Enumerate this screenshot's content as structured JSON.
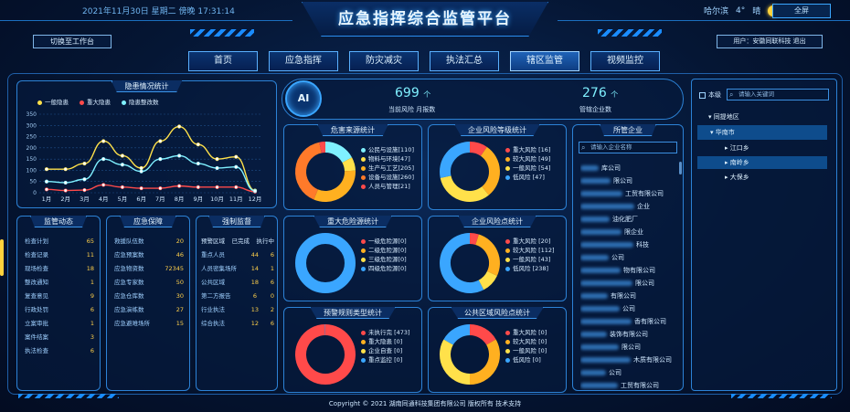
{
  "header": {
    "title": "应急指挥综合监管平台",
    "datetime": "2021年11月30日 星期二 傍晚 17:31:14",
    "location": "哈尔滨",
    "temperature": "4°",
    "weather": "晴",
    "fullscreen_label": "全屏",
    "switch_label": "切换至工作台",
    "user_label": "用户：安徽同联科技  退出"
  },
  "nav": {
    "tabs": [
      {
        "label": "首页"
      },
      {
        "label": "应急指挥"
      },
      {
        "label": "防灾减灾"
      },
      {
        "label": "执法汇总"
      },
      {
        "label": "辖区监管"
      },
      {
        "label": "视频监控"
      }
    ],
    "active_index": 4
  },
  "hazard_chart": {
    "title": "隐患情况统计",
    "legend": [
      "一般隐患",
      "重大隐患",
      "隐患整改数"
    ],
    "colors": [
      "#ffe14a",
      "#ff4a4a",
      "#7ff0ff"
    ]
  },
  "chart_data": {
    "type": "line",
    "categories": [
      "1月",
      "2月",
      "3月",
      "4月",
      "5月",
      "6月",
      "7月",
      "8月",
      "9月",
      "10月",
      "11月",
      "12月"
    ],
    "ylim": [
      0,
      350
    ],
    "yticks": [
      0,
      50,
      100,
      150,
      200,
      250,
      300,
      350
    ],
    "series": [
      {
        "name": "一般隐患",
        "color": "#ffe14a",
        "values": [
          105,
          105,
          130,
          230,
          165,
          110,
          230,
          295,
          215,
          150,
          160,
          10
        ]
      },
      {
        "name": "重大隐患",
        "color": "#ff4a4a",
        "values": [
          15,
          10,
          12,
          35,
          25,
          20,
          20,
          30,
          25,
          25,
          25,
          5
        ]
      },
      {
        "name": "隐患整改数",
        "color": "#7ff0ff",
        "values": [
          50,
          45,
          60,
          150,
          125,
          95,
          150,
          165,
          130,
          110,
          115,
          8
        ]
      }
    ]
  },
  "stats": {
    "current_risk_value": "699",
    "current_risk_unit": "个",
    "current_risk_label": "当前风险 月报数",
    "enterprise_value": "276",
    "enterprise_unit": "个",
    "enterprise_label": "管辖企业数"
  },
  "donuts": [
    {
      "title": "危害来源统计",
      "colors": [
        "#7ff0ff",
        "#ffe14a",
        "#ffb020",
        "#ff7a2a",
        "#ff4a4a"
      ],
      "legend": [
        {
          "label": "公民与设施[110]"
        },
        {
          "label": "物料与环境[47]"
        },
        {
          "label": "生产与工艺[205]"
        },
        {
          "label": "设备与设施[260]"
        },
        {
          "label": "人员与管理[21]"
        }
      ],
      "values": [
        110,
        47,
        205,
        260,
        21
      ]
    },
    {
      "title": "企业风险等级统计",
      "colors": [
        "#ff4a4a",
        "#ffb020",
        "#ffe14a",
        "#3aa6ff"
      ],
      "legend": [
        {
          "label": "重大风险 [16]"
        },
        {
          "label": "较大风险 [49]"
        },
        {
          "label": "一般风险 [54]"
        },
        {
          "label": "低风险 [47]"
        }
      ],
      "values": [
        16,
        49,
        54,
        47
      ]
    },
    {
      "title": "重大危险源统计",
      "colors": [
        "#ff4a4a",
        "#ffb020",
        "#ffe14a",
        "#3aa6ff"
      ],
      "legend": [
        {
          "label": "一级危险源[0]"
        },
        {
          "label": "二级危险源[0]"
        },
        {
          "label": "三级危险源[0]"
        },
        {
          "label": "四级危险源[0]"
        }
      ],
      "values": [
        0,
        0,
        0,
        1
      ]
    },
    {
      "title": "企业风险点统计",
      "colors": [
        "#ff4a4a",
        "#ffb020",
        "#ffe14a",
        "#3aa6ff"
      ],
      "legend": [
        {
          "label": "重大风险 [20]"
        },
        {
          "label": "较大风险 [112]"
        },
        {
          "label": "一般风险 [43]"
        },
        {
          "label": "低风险 [238]"
        }
      ],
      "values": [
        20,
        112,
        43,
        238
      ]
    },
    {
      "title": "预警规则类型统计",
      "colors": [
        "#ff4a4a",
        "#ffb020",
        "#ffe14a",
        "#3aa6ff"
      ],
      "legend": [
        {
          "label": "未执行完 [473]"
        },
        {
          "label": "重大隐患 [0]"
        },
        {
          "label": "企业自查 [0]"
        },
        {
          "label": "重点监控 [0]"
        }
      ],
      "values": [
        473,
        0,
        0,
        1
      ]
    },
    {
      "title": "公共区域风险点统计",
      "colors": [
        "#ff4a4a",
        "#ffb020",
        "#ffe14a",
        "#3aa6ff"
      ],
      "legend": [
        {
          "label": "重大风险 [0]"
        },
        {
          "label": "较大风险 [0]"
        },
        {
          "label": "一般风险 [0]"
        },
        {
          "label": "低风险 [0]"
        }
      ],
      "values": [
        1,
        2,
        2,
        1
      ]
    }
  ],
  "supervision": {
    "title": "监管动态",
    "rows": [
      {
        "label": "检查计划",
        "value": "65"
      },
      {
        "label": "检查记录",
        "value": "11"
      },
      {
        "label": "现场检查",
        "value": "18"
      },
      {
        "label": "整改通知",
        "value": "1"
      },
      {
        "label": "复查意见",
        "value": "9"
      },
      {
        "label": "行政处罚",
        "value": "6"
      },
      {
        "label": "立案审批",
        "value": "1"
      },
      {
        "label": "案件结案",
        "value": "3"
      },
      {
        "label": "执法检查",
        "value": "6"
      }
    ]
  },
  "emergency": {
    "title": "应急保障",
    "rows": [
      {
        "label": "救援队伍数",
        "value": "20"
      },
      {
        "label": "应急预案数",
        "value": "46"
      },
      {
        "label": "应急物资数",
        "value": "72345"
      },
      {
        "label": "应急专家数",
        "value": "50"
      },
      {
        "label": "应急仓库数",
        "value": "30"
      },
      {
        "label": "应急演练数",
        "value": "27"
      },
      {
        "label": "应急避难场所",
        "value": "15"
      }
    ]
  },
  "risk_control": {
    "title": "强制监督",
    "headers": [
      "预警区域",
      "已完成",
      "执行中"
    ],
    "rows": [
      {
        "label": "重点人员",
        "a": "44",
        "b": "6"
      },
      {
        "label": "人员密集场所",
        "a": "14",
        "b": "1"
      },
      {
        "label": "公共区域",
        "a": "18",
        "b": "6"
      },
      {
        "label": "第二方报告",
        "a": "6",
        "b": "0"
      },
      {
        "label": "行业执法",
        "a": "13",
        "b": "2"
      },
      {
        "label": "综合执法",
        "a": "12",
        "b": "6"
      }
    ]
  },
  "company_panel": {
    "title": "所管企业",
    "search_placeholder": "请输入企业名称",
    "items": [
      {
        "suffix": "库公司"
      },
      {
        "suffix": "限公司"
      },
      {
        "suffix": "工贸有限公司"
      },
      {
        "suffix": "企业"
      },
      {
        "suffix": "油化肥厂"
      },
      {
        "suffix": "限企业"
      },
      {
        "suffix": "科技"
      },
      {
        "suffix": "公司"
      },
      {
        "suffix": "物有限公司"
      },
      {
        "suffix": "限公司"
      },
      {
        "suffix": "有限公司"
      },
      {
        "suffix": "公司"
      },
      {
        "suffix": "香有限公司"
      },
      {
        "suffix": "装饰有限公司"
      },
      {
        "suffix": "限公司"
      },
      {
        "suffix": "木质有限公司"
      },
      {
        "suffix": "公司"
      },
      {
        "suffix": "工贸有限公司"
      }
    ]
  },
  "region_tree": {
    "checkbox_label": "本级",
    "search_placeholder": "请输入关键词",
    "root": "同提地区",
    "level1": "华南市",
    "children": [
      "江口乡",
      "南岭乡",
      "大保乡"
    ]
  },
  "footer": {
    "copyright": "Copyright © 2021 湖南同通科技集团有限公司 版权所有 技术支持"
  }
}
